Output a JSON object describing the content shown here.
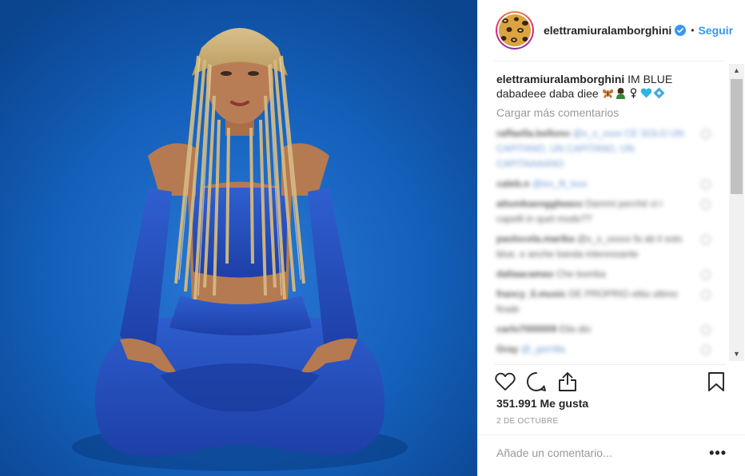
{
  "post": {
    "username": "elettramiuralamborghini",
    "follow_label": "Seguir",
    "separator": "•",
    "caption_user": "elettramiuralamborghini",
    "caption_text": "IM BLUE dabadeee daba diee",
    "load_more_label": "Cargar más comentarios",
    "likes": "351.991 Me gusta",
    "date": "2 DE OCTUBRE",
    "add_comment_placeholder": "Añade un comentario...",
    "more_label": "•••"
  },
  "blurred_comments": [
    {
      "user": "raffaella.bellono",
      "text": "@x_x_xxxx CE SOLO UN CAPITANO, UN CAPITANO, UN CAPITAAAANO"
    },
    {
      "user": "caleb.n",
      "text": "@lxx_lll_lxxx"
    },
    {
      "user": "attumkaengglwaxo",
      "text": "Dammi perché ci i capelli in quel modo??"
    },
    {
      "user": "paolocela.marika",
      "text": "@x_x_xxxxx fa ab il solo blue, e anche banda interessante"
    },
    {
      "user": "daliaacamas",
      "text": "Che bomba"
    },
    {
      "user": "francy_li.music",
      "text": "DE PROPRIO elita ultimo finale"
    },
    {
      "user": "carlo7000009",
      "text": "Ella dio"
    },
    {
      "user": "Gray",
      "text": "@_gorrilla"
    }
  ],
  "icons": {
    "heart": "heart-icon",
    "comment": "comment-icon",
    "share": "share-icon",
    "bookmark": "bookmark-icon",
    "verified": "verified-badge-icon"
  },
  "colors": {
    "link_blue": "#3897f0",
    "muted": "#999999",
    "text": "#262626",
    "photo_blue": "#115ab3"
  }
}
